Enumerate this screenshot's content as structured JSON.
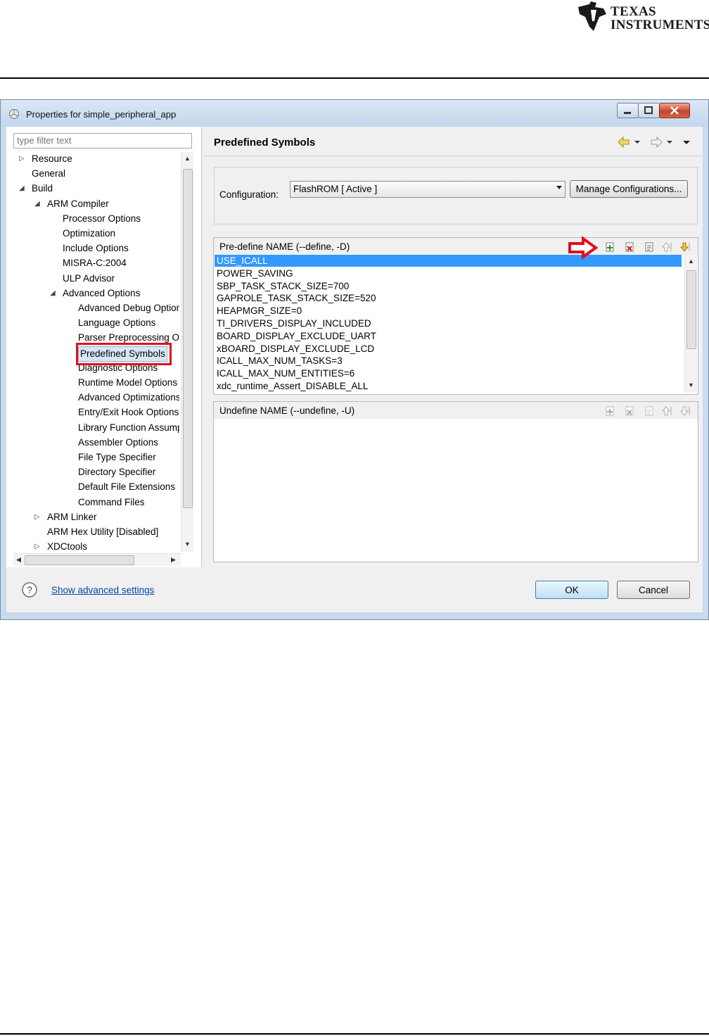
{
  "brand": {
    "line1": "TEXAS",
    "line2": "INSTRUMENTS"
  },
  "window": {
    "title": "Properties for simple_peripheral_app"
  },
  "filter": {
    "placeholder": "type filter text"
  },
  "tree": {
    "items": [
      {
        "label": "Resource",
        "indent": 0,
        "arrow": "collapsed"
      },
      {
        "label": "General",
        "indent": 0,
        "arrow": "none"
      },
      {
        "label": "Build",
        "indent": 0,
        "arrow": "expanded"
      },
      {
        "label": "ARM Compiler",
        "indent": 1,
        "arrow": "expanded"
      },
      {
        "label": "Processor Options",
        "indent": 2,
        "arrow": "none"
      },
      {
        "label": "Optimization",
        "indent": 2,
        "arrow": "none"
      },
      {
        "label": "Include Options",
        "indent": 2,
        "arrow": "none"
      },
      {
        "label": "MISRA-C:2004",
        "indent": 2,
        "arrow": "none"
      },
      {
        "label": "ULP Advisor",
        "indent": 2,
        "arrow": "none"
      },
      {
        "label": "Advanced Options",
        "indent": 2,
        "arrow": "expanded"
      },
      {
        "label": "Advanced Debug Options",
        "indent": 3,
        "arrow": "none"
      },
      {
        "label": "Language Options",
        "indent": 3,
        "arrow": "none"
      },
      {
        "label": "Parser Preprocessing Options",
        "indent": 3,
        "arrow": "none"
      },
      {
        "label": "Predefined Symbols",
        "indent": 3,
        "arrow": "none",
        "selected": true
      },
      {
        "label": "Diagnostic Options",
        "indent": 3,
        "arrow": "none"
      },
      {
        "label": "Runtime Model Options",
        "indent": 3,
        "arrow": "none"
      },
      {
        "label": "Advanced Optimizations",
        "indent": 3,
        "arrow": "none"
      },
      {
        "label": "Entry/Exit Hook Options",
        "indent": 3,
        "arrow": "none"
      },
      {
        "label": "Library Function Assumptions",
        "indent": 3,
        "arrow": "none"
      },
      {
        "label": "Assembler Options",
        "indent": 3,
        "arrow": "none"
      },
      {
        "label": "File Type Specifier",
        "indent": 3,
        "arrow": "none"
      },
      {
        "label": "Directory Specifier",
        "indent": 3,
        "arrow": "none"
      },
      {
        "label": "Default File Extensions",
        "indent": 3,
        "arrow": "none"
      },
      {
        "label": "Command Files",
        "indent": 3,
        "arrow": "none"
      },
      {
        "label": "ARM Linker",
        "indent": 1,
        "arrow": "collapsed"
      },
      {
        "label": "ARM Hex Utility  [Disabled]",
        "indent": 1,
        "arrow": "none"
      },
      {
        "label": "XDCtools",
        "indent": 1,
        "arrow": "collapsed"
      }
    ]
  },
  "page": {
    "title": "Predefined Symbols",
    "configuration": {
      "label": "Configuration:",
      "value": "FlashROM  [ Active ]",
      "manage_button": "Manage Configurations..."
    },
    "define_panel": {
      "title": "Pre-define NAME (--define, -D)",
      "symbols": [
        "USE_ICALL",
        "POWER_SAVING",
        "SBP_TASK_STACK_SIZE=700",
        "GAPROLE_TASK_STACK_SIZE=520",
        "HEAPMGR_SIZE=0",
        "TI_DRIVERS_DISPLAY_INCLUDED",
        "BOARD_DISPLAY_EXCLUDE_UART",
        "xBOARD_DISPLAY_EXCLUDE_LCD",
        "ICALL_MAX_NUM_TASKS=3",
        "ICALL_MAX_NUM_ENTITIES=6",
        "xdc_runtime_Assert_DISABLE_ALL"
      ],
      "selected_index": 0,
      "tools": [
        "add-icon",
        "delete-icon",
        "edit-icon",
        "move-up-icon",
        "move-down-icon"
      ]
    },
    "undefine_panel": {
      "title": "Undefine NAME (--undefine, -U)",
      "tools": [
        "add-icon",
        "delete-icon",
        "edit-icon",
        "move-up-icon",
        "move-down-icon"
      ]
    }
  },
  "footer": {
    "advanced_link": "Show advanced settings",
    "ok": "OK",
    "cancel": "Cancel"
  },
  "colors": {
    "selection": "#3399ff",
    "annotation_red": "#e0101c",
    "link": "#0645ad"
  }
}
